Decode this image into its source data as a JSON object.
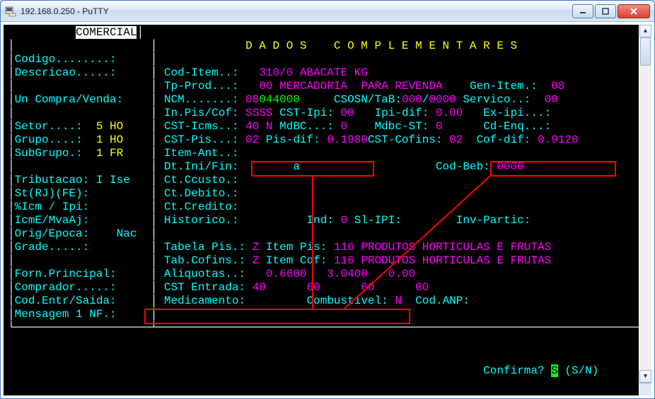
{
  "window": {
    "title": "192.168.0.250 - PuTTY",
    "icon": "putty-icon"
  },
  "left_panel": {
    "header": "COMERCIAL",
    "lines": {
      "codigo": "Codigo........:",
      "descricao": "Descricao.....:",
      "blank1": "               ",
      "uncv": "Un Compra/Venda:",
      "blank2": "               ",
      "setor_lbl": "Setor....:",
      "setor_val": "5 HO",
      "grupo_lbl": "Grupo....:",
      "grupo_val": "1 HO",
      "subgr_lbl": "SubGrupo.:",
      "subgr_val": "1 FR",
      "blank3": "               ",
      "trib_lbl": "Tributacao:",
      "trib_val": "I Ise",
      "strj": "St(RJ)(FE):",
      "icmipi": "%Icm / Ipi:",
      "icme": "IcmE/MvaAj:",
      "orig_lbl": "Orig/Epoca:",
      "orig_val": "Nac",
      "grade": "Grade.....:",
      "blank4": "               ",
      "fornp": "Forn.Principal:",
      "compr": "Comprador.....:",
      "codentr": "Cod.Entr/Saida:",
      "msg1": "Mensagem 1 NF.:"
    }
  },
  "right_panel": {
    "title": "D A D O S    C O M P L E M E N T A R E S",
    "cod_item_lbl": "Cod-Item..:",
    "cod_item_val": "310/0 ABACATE KG",
    "tp_prod_lbl": "Tp-Prod...:",
    "tp_prod_val": "00 MERCADORIA  PARA REVENDA",
    "gen_item_lbl": "Gen-Item.:",
    "gen_item_val": "08",
    "ncm_lbl": "NCM.......:",
    "ncm_valA": "08",
    "ncm_valB": "044000",
    "csosn_lbl": "CSOSN/TaB:",
    "csosn_valA": "000",
    "csosn_sep": "/",
    "csosn_valB": "0000",
    "servico_lbl": "Servico..:",
    "servico_val": "00",
    "inpis_lbl": "In.Pis/Cof:",
    "inpis_val": "SSSS",
    "cstipi_lbl": "CST-Ipi:",
    "cstipi_val": "00",
    "ipidif_lbl": "Ipi-dif:",
    "ipidif_val": "0.00",
    "exipi_lbl": "Ex-ipi...:",
    "csticms_lbl": "CST-Icms..:",
    "csticms_val": "40 N",
    "mdbc_lbl": "MdBC...:",
    "mdbc_val": "0",
    "mdbcst_lbl": "Mdbc-ST:",
    "mdbcst_val": "0",
    "cdenq_lbl": "Cd-Enq...:",
    "cstpis_lbl": "CST-Pis...:",
    "cstpis_val": "02",
    "pisdif_lbl": "Pis-dif:",
    "pisdif_val": "0.1980",
    "cstcof_lbl": "CST-Cofins:",
    "cstcof_val": "02",
    "cofdif_lbl": "Cof-dif:",
    "cofdif_val": "0.9120",
    "itemant_lbl": "Item-Ant..:",
    "dtini_lbl": "Dt.Ini/Fin:",
    "dtini_val": "a",
    "codbeb_lbl": "Cod-Beb:",
    "codbeb_val": "0000",
    "ctccusto": "Ct.Ccusto.:",
    "ctdebito": "Ct.Debito.:",
    "ctcredito": "Ct.Credito:",
    "historico_lbl": "Historico.:",
    "ind_lbl": "Ind:",
    "ind_val": "0",
    "slipi_lbl": "Sl-IPI:",
    "invpart_lbl": "Inv-Partic:",
    "tabpis_lbl": "Tabela Pis.:",
    "tabpis_val": "Z",
    "itempis_lbl": "Item Pis:",
    "itempis_val": "116 PRODUTOS HORTICULAS E FRUTAS",
    "tabcof_lbl": "Tab.Cofins.:",
    "tabcof_val": "Z",
    "itemcof_lbl": "Item Cof:",
    "itemcof_val": "116 PRODUTOS HORTICULAS E FRUTAS",
    "aliq_lbl": "Aliquotas..:",
    "aliq_v1": "0.6600",
    "aliq_v2": "3.0400",
    "aliq_v3": "0.00",
    "cstent_lbl": "CST Entrada:",
    "cstent_40": "40",
    "cstent_60a": "60",
    "cstent_60b": "60",
    "cstent_00": "00",
    "medic_lbl": "Medicamento:",
    "combust_lbl": "Combustivel:",
    "combust_val": "N",
    "codanp_lbl": "Cod.ANP:"
  },
  "prompt": {
    "label": "Confirma?",
    "value": "S",
    "hint": "(S/N)"
  }
}
